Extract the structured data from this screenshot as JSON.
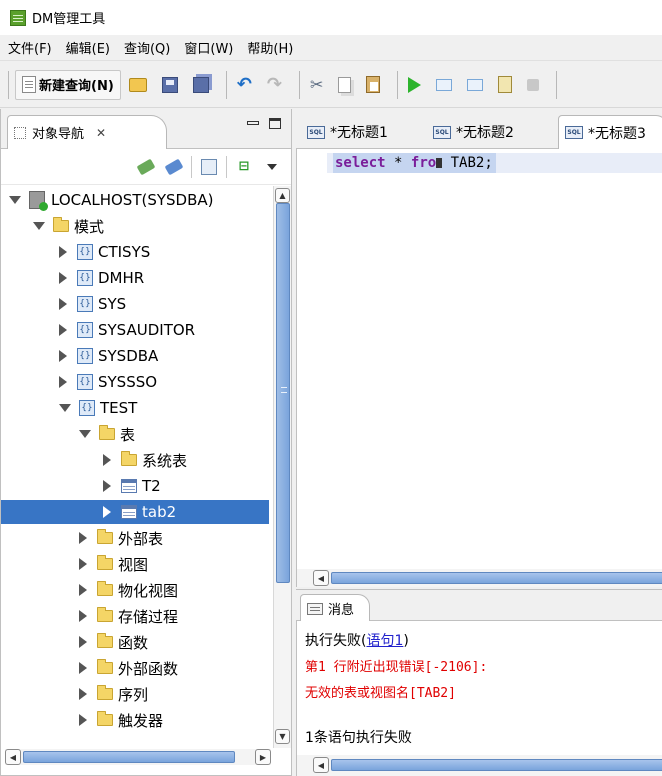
{
  "window": {
    "title": "DM管理工具"
  },
  "menu": [
    "文件(F)",
    "编辑(E)",
    "查询(Q)",
    "窗口(W)",
    "帮助(H)"
  ],
  "toolbar": {
    "new_query_label": "新建查询(N)"
  },
  "navigator": {
    "tab_label": "对象导航",
    "close_glyph": "✕",
    "tree": [
      {
        "label": "LOCALHOST(SYSDBA)",
        "icon": "server-icon",
        "level": 0,
        "expanded": true
      },
      {
        "label": "模式",
        "icon": "folder-icon",
        "level": 1,
        "expanded": true
      },
      {
        "label": "CTISYS",
        "icon": "schema-icon",
        "level": 2,
        "expanded": false
      },
      {
        "label": "DMHR",
        "icon": "schema-icon",
        "level": 2,
        "expanded": false
      },
      {
        "label": "SYS",
        "icon": "schema-icon",
        "level": 2,
        "expanded": false
      },
      {
        "label": "SYSAUDITOR",
        "icon": "schema-icon",
        "level": 2,
        "expanded": false
      },
      {
        "label": "SYSDBA",
        "icon": "schema-icon",
        "level": 2,
        "expanded": false
      },
      {
        "label": "SYSSSO",
        "icon": "schema-icon",
        "level": 2,
        "expanded": false
      },
      {
        "label": "TEST",
        "icon": "schema-icon",
        "level": 2,
        "expanded": true
      },
      {
        "label": "表",
        "icon": "folder-icon",
        "level": 3,
        "expanded": true
      },
      {
        "label": "系统表",
        "icon": "folder-icon",
        "level": 4,
        "expanded": false
      },
      {
        "label": "T2",
        "icon": "table-icon",
        "level": 4,
        "expanded": false
      },
      {
        "label": "tab2",
        "icon": "table-icon",
        "level": 4,
        "expanded": false,
        "selected": true
      },
      {
        "label": "外部表",
        "icon": "folder-icon",
        "level": 3,
        "expanded": false
      },
      {
        "label": "视图",
        "icon": "folder-icon",
        "level": 3,
        "expanded": false
      },
      {
        "label": "物化视图",
        "icon": "folder-icon",
        "level": 3,
        "expanded": false
      },
      {
        "label": "存储过程",
        "icon": "folder-icon",
        "level": 3,
        "expanded": false
      },
      {
        "label": "函数",
        "icon": "folder-icon",
        "level": 3,
        "expanded": false
      },
      {
        "label": "外部函数",
        "icon": "folder-icon",
        "level": 3,
        "expanded": false
      },
      {
        "label": "序列",
        "icon": "folder-icon",
        "level": 3,
        "expanded": false
      },
      {
        "label": "触发器",
        "icon": "folder-icon",
        "level": 3,
        "expanded": false
      }
    ]
  },
  "editor": {
    "tabs": [
      {
        "label": "*无标题1",
        "active": false
      },
      {
        "label": "*无标题2",
        "active": false
      },
      {
        "label": "*无标题3",
        "active": true
      }
    ],
    "tab_icon_text": "SQL",
    "code": {
      "kw1": "select",
      "star": "*",
      "kw2": "fro",
      "rest": " TAB2;"
    }
  },
  "messages": {
    "tab_label": "消息",
    "lines": {
      "fail_prefix": "执行失败(",
      "fail_link": "语句1",
      "fail_suffix": ")",
      "error_line1": "第1 行附近出现错误[-2106]:",
      "error_line2": "无效的表或视图名[TAB2]",
      "summary": "1条语句执行失败"
    }
  },
  "colors": {
    "selection": "#3875c5",
    "error_text": "#e00000",
    "keyword": "#7a1e9a"
  }
}
